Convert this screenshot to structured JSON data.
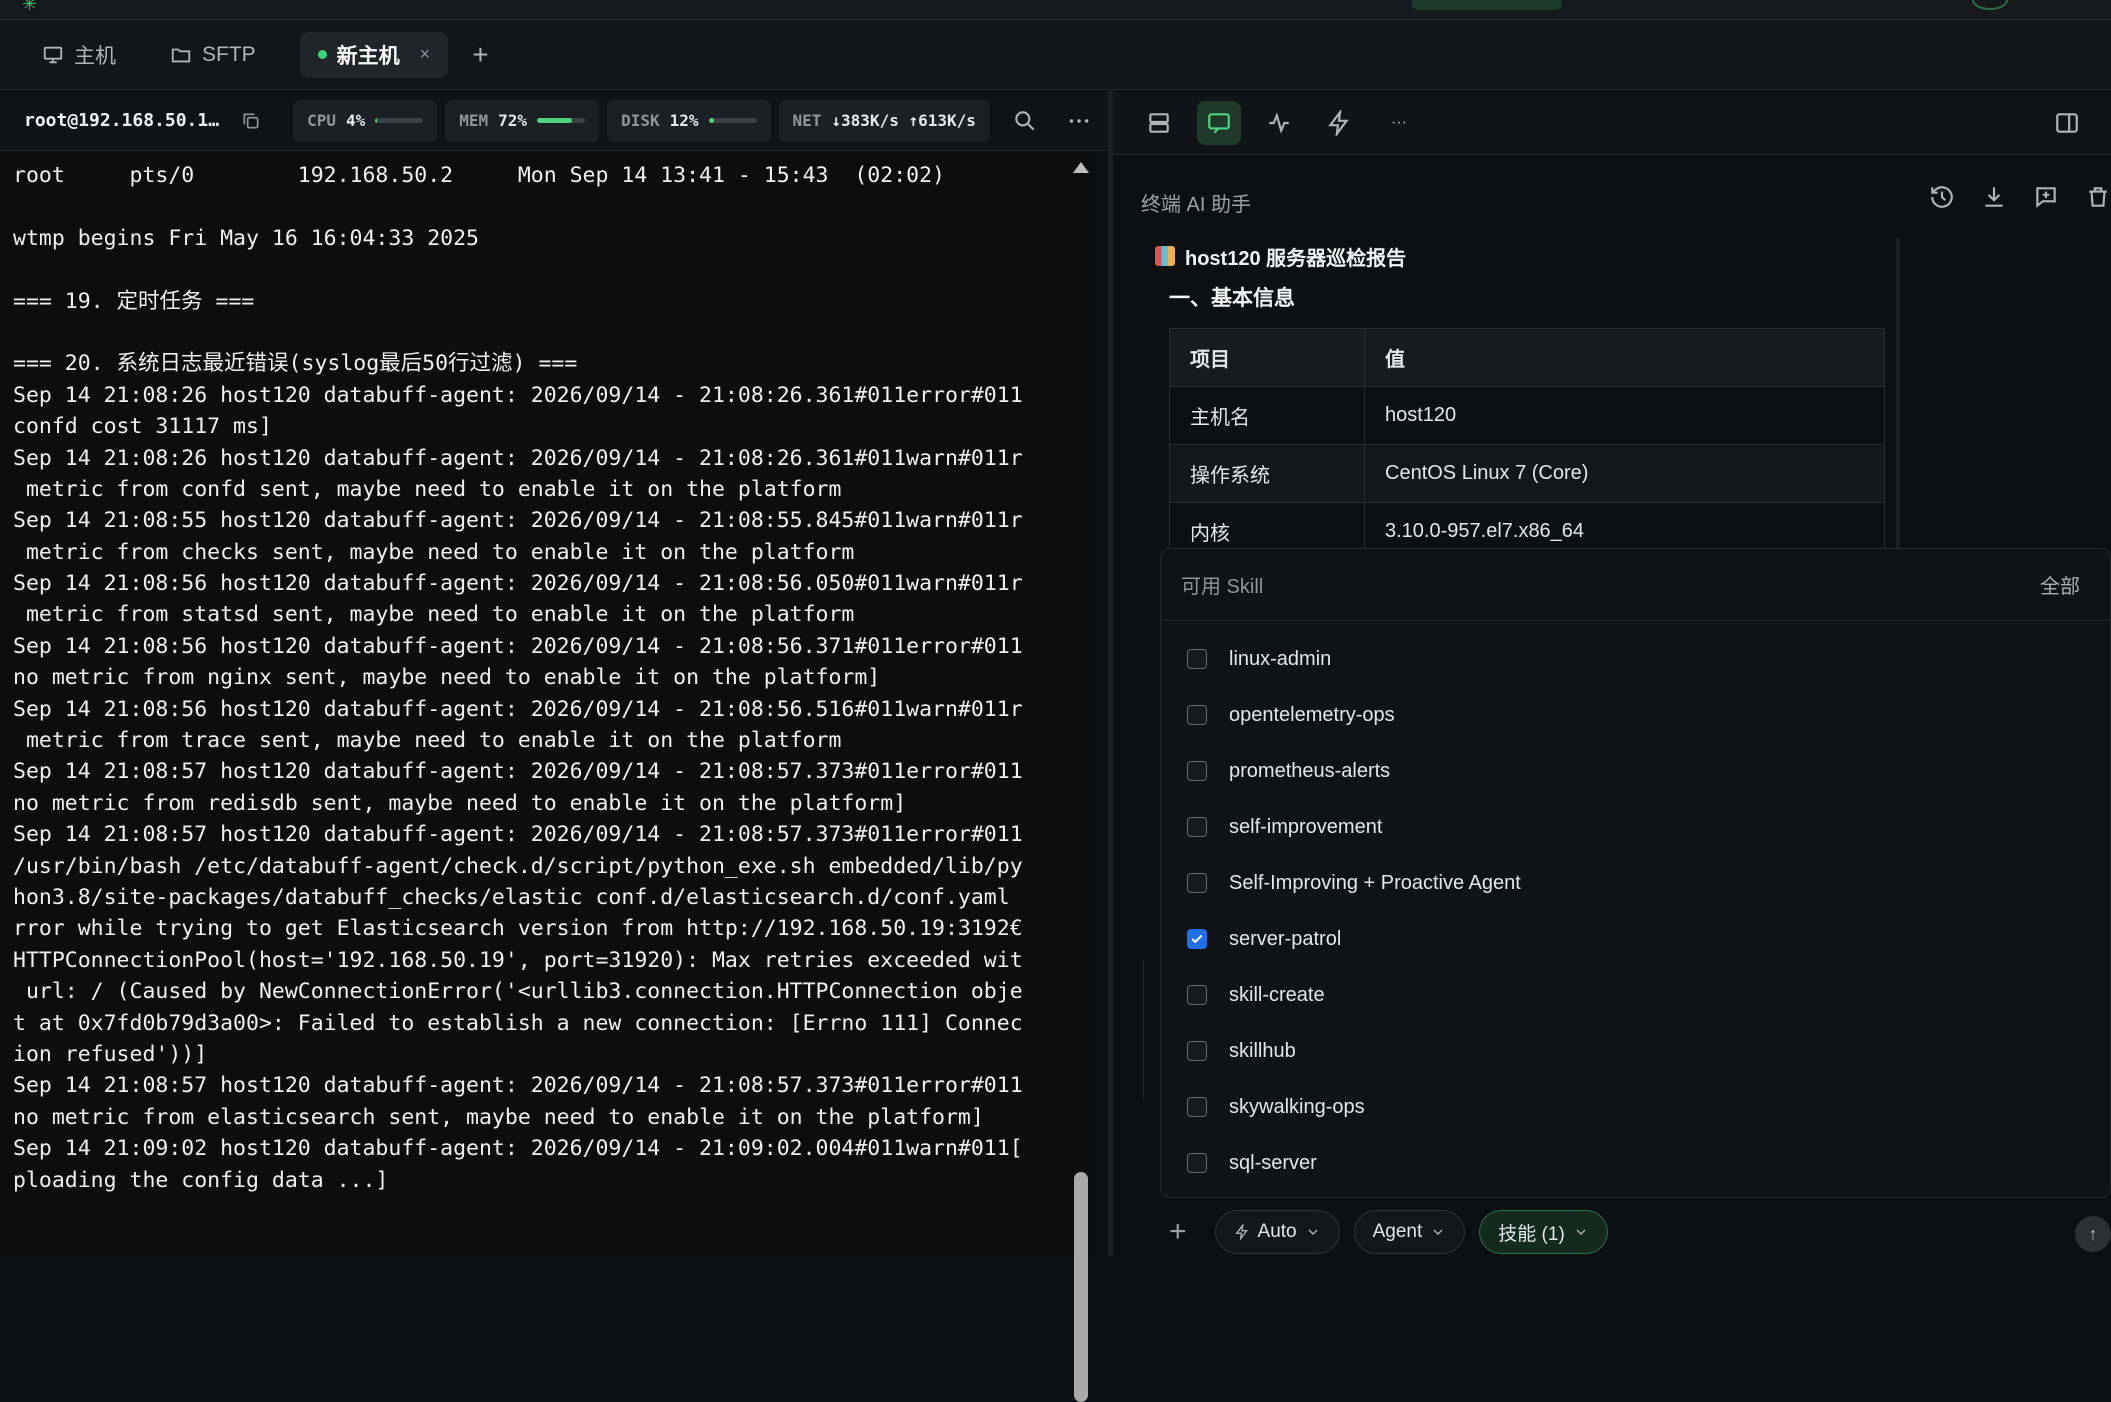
{
  "tabs": [
    {
      "label": "主机",
      "icon": "monitor-icon"
    },
    {
      "label": "SFTP",
      "icon": "folder-icon"
    },
    {
      "label": "新主机",
      "close": "×",
      "active": true
    }
  ],
  "tab_add": "+",
  "status": {
    "host": "root@192.168.50.1…",
    "cpu": {
      "label": "CPU",
      "value": "4%",
      "fill": 0.04
    },
    "mem": {
      "label": "MEM",
      "value": "72%",
      "fill": 0.72
    },
    "disk": {
      "label": "DISK",
      "value": "12%",
      "fill": 0.12
    },
    "net": {
      "label": "NET",
      "value": "↓383K/s ↑613K/s"
    }
  },
  "terminal_lines": [
    "root     pts/0        192.168.50.2     Mon Sep 14 13:41 - 15:43  (02:02)",
    "",
    "wtmp begins Fri May 16 16:04:33 2025",
    "",
    "=== 19. 定时任务 ===",
    "",
    "=== 20. 系统日志最近错误(syslog最后50行过滤) ===",
    "Sep 14 21:08:26 host120 databuff-agent: 2026/09/14 - 21:08:26.361#011error#011",
    "confd cost 31117 ms]",
    "Sep 14 21:08:26 host120 databuff-agent: 2026/09/14 - 21:08:26.361#011warn#011r",
    " metric from confd sent, maybe need to enable it on the platform",
    "Sep 14 21:08:55 host120 databuff-agent: 2026/09/14 - 21:08:55.845#011warn#011r",
    " metric from checks sent, maybe need to enable it on the platform",
    "Sep 14 21:08:56 host120 databuff-agent: 2026/09/14 - 21:08:56.050#011warn#011r",
    " metric from statsd sent, maybe need to enable it on the platform",
    "Sep 14 21:08:56 host120 databuff-agent: 2026/09/14 - 21:08:56.371#011error#011",
    "no metric from nginx sent, maybe need to enable it on the platform]",
    "Sep 14 21:08:56 host120 databuff-agent: 2026/09/14 - 21:08:56.516#011warn#011r",
    " metric from trace sent, maybe need to enable it on the platform",
    "Sep 14 21:08:57 host120 databuff-agent: 2026/09/14 - 21:08:57.373#011error#011",
    "no metric from redisdb sent, maybe need to enable it on the platform]",
    "Sep 14 21:08:57 host120 databuff-agent: 2026/09/14 - 21:08:57.373#011error#011",
    "/usr/bin/bash /etc/databuff-agent/check.d/script/python_exe.sh embedded/lib/py",
    "hon3.8/site-packages/databuff_checks/elastic conf.d/elasticsearch.d/conf.yaml",
    "rror while trying to get Elasticsearch version from http://192.168.50.19:3192€",
    "HTTPConnectionPool(host='192.168.50.19', port=31920): Max retries exceeded wit",
    " url: / (Caused by NewConnectionError('<urllib3.connection.HTTPConnection obje",
    "t at 0x7fd0b79d3a00>: Failed to establish a new connection: [Errno 111] Connec",
    "ion refused'))]",
    "Sep 14 21:08:57 host120 databuff-agent: 2026/09/14 - 21:08:57.373#011error#011",
    "no metric from elasticsearch sent, maybe need to enable it on the platform]",
    "Sep 14 21:09:02 host120 databuff-agent: 2026/09/14 - 21:09:02.004#011warn#011[",
    "ploading the config data ...]"
  ],
  "right_toolbar": {
    "buttons": [
      "layout-list-icon",
      "chat-icon",
      "activity-icon",
      "lightning-icon",
      "more-icon"
    ],
    "active": "chat-icon",
    "more": "···"
  },
  "ai": {
    "title": "终端 AI 助手"
  },
  "report": {
    "title": "host120 服务器巡检报告",
    "section": "一、基本信息",
    "columns": [
      "项目",
      "值"
    ],
    "rows": [
      [
        "主机名",
        "host120"
      ],
      [
        "操作系统",
        "CentOS Linux 7 (Core)"
      ],
      [
        "内核",
        "3.10.0-957.el7.x86_64"
      ]
    ]
  },
  "skills": {
    "header": "可用 Skill",
    "all_label": "全部",
    "items": [
      {
        "name": "linux-admin",
        "checked": false
      },
      {
        "name": "opentelemetry-ops",
        "checked": false
      },
      {
        "name": "prometheus-alerts",
        "checked": false
      },
      {
        "name": "self-improvement",
        "checked": false
      },
      {
        "name": "Self-Improving + Proactive Agent",
        "checked": false
      },
      {
        "name": "server-patrol",
        "checked": true
      },
      {
        "name": "skill-create",
        "checked": false
      },
      {
        "name": "skillhub",
        "checked": false
      },
      {
        "name": "skywalking-ops",
        "checked": false
      },
      {
        "name": "sql-server",
        "checked": false
      }
    ]
  },
  "composer": {
    "plus": "+",
    "auto": "Auto",
    "agent": "Agent",
    "skills": "技能 (1)",
    "send": "↑"
  },
  "colors": {
    "accent_green": "#4fd37f",
    "checkbox_blue": "#1f6feb",
    "background": "#0b0d0e"
  }
}
